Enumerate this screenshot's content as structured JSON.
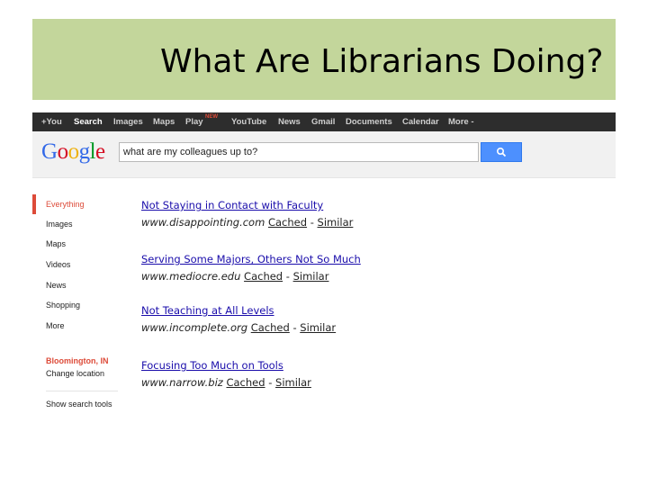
{
  "slide": {
    "title": "What Are Librarians Doing?"
  },
  "gbar": {
    "items": [
      "+You",
      "Search",
      "Images",
      "Maps",
      "Play",
      "YouTube",
      "News",
      "Gmail",
      "Documents",
      "Calendar",
      "More -"
    ],
    "new_badge": "NEW"
  },
  "header": {
    "logo": [
      "G",
      "o",
      "o",
      "g",
      "l",
      "e"
    ],
    "logo_colors": [
      "#3369e8",
      "#d50f25",
      "#eeb211",
      "#3369e8",
      "#009925",
      "#d50f25"
    ],
    "search_value": "what are my colleagues up to?"
  },
  "sidebar": {
    "items": [
      "Everything",
      "Images",
      "Maps",
      "Videos",
      "News",
      "Shopping",
      "More"
    ],
    "location": "Bloomington, IN",
    "change_location": "Change location",
    "show_tools": "Show search tools"
  },
  "results": [
    {
      "title": "Not Staying in Contact with Faculty",
      "url": "www.disappointing.com",
      "cached": "Cached",
      "sep": " - ",
      "similar": "Similar"
    },
    {
      "title": "Serving Some Majors, Others Not So Much",
      "url": "www.mediocre.edu",
      "cached": "Cached",
      "sep": " - ",
      "similar": "Similar"
    },
    {
      "title": "Not Teaching at All Levels",
      "url": "www.incomplete.org",
      "cached": "Cached",
      "sep": " - ",
      "similar": "Similar"
    },
    {
      "title": "Focusing Too Much on Tools",
      "url": "www.narrow.biz",
      "cached": "Cached",
      "sep": " - ",
      "similar": "Similar"
    }
  ],
  "colors": {
    "title_band": "#c3d69b",
    "gbar": "#2d2d2d",
    "accent": "#dd4b39",
    "link": "#1a0dab",
    "button": "#4d90fe"
  }
}
